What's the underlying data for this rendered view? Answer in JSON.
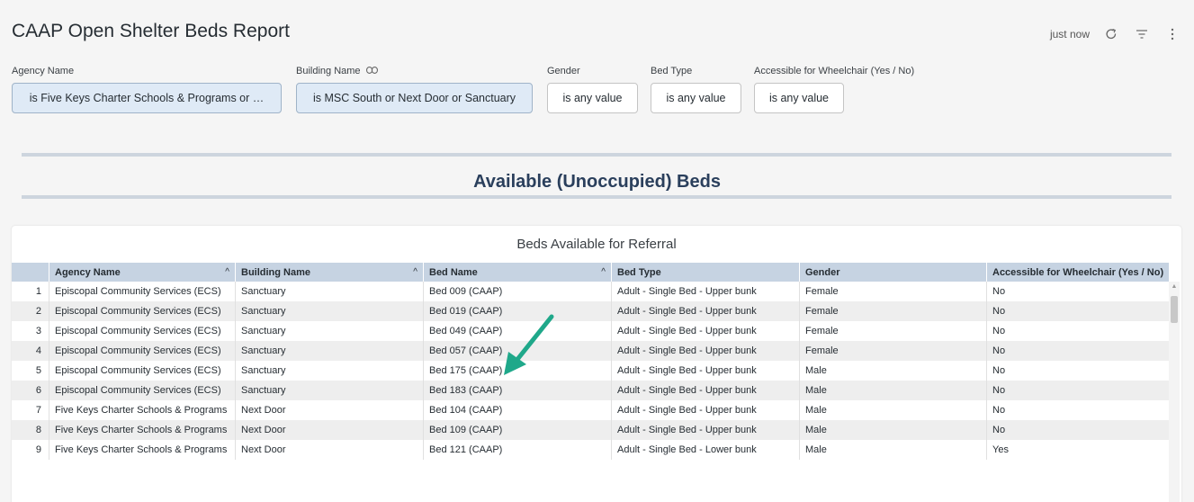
{
  "header": {
    "title": "CAAP Open Shelter Beds Report",
    "refreshed": "just now",
    "icons": [
      "refresh-icon",
      "filter-icon",
      "more-vertical-icon"
    ]
  },
  "filters": [
    {
      "label": "Agency Name",
      "value": "is Five Keys Charter Schools & Programs or …",
      "active": true
    },
    {
      "label": "Building Name",
      "value": "is MSC South or Next Door or Sanctuary",
      "active": true,
      "icon": "link-icon"
    },
    {
      "label": "Gender",
      "value": "is any value",
      "active": false
    },
    {
      "label": "Bed Type",
      "value": "is any value",
      "active": false
    },
    {
      "label": "Accessible for Wheelchair (Yes / No)",
      "value": "is any value",
      "active": false
    }
  ],
  "section": {
    "title": "Available (Unoccupied) Beds"
  },
  "table": {
    "title": "Beds Available for Referral",
    "columns": [
      "",
      "Agency Name",
      "Building Name",
      "Bed Name",
      "Bed Type",
      "Gender",
      "Accessible for Wheelchair (Yes / No)"
    ],
    "rows": [
      [
        "1",
        "Episcopal Community Services (ECS)",
        "Sanctuary",
        "Bed 009 (CAAP)",
        "Adult - Single Bed - Upper bunk",
        "Female",
        "No"
      ],
      [
        "2",
        "Episcopal Community Services (ECS)",
        "Sanctuary",
        "Bed 019 (CAAP)",
        "Adult - Single Bed - Upper bunk",
        "Female",
        "No"
      ],
      [
        "3",
        "Episcopal Community Services (ECS)",
        "Sanctuary",
        "Bed 049 (CAAP)",
        "Adult - Single Bed - Upper bunk",
        "Female",
        "No"
      ],
      [
        "4",
        "Episcopal Community Services (ECS)",
        "Sanctuary",
        "Bed 057 (CAAP)",
        "Adult - Single Bed - Upper bunk",
        "Female",
        "No"
      ],
      [
        "5",
        "Episcopal Community Services (ECS)",
        "Sanctuary",
        "Bed 175 (CAAP)",
        "Adult - Single Bed - Upper bunk",
        "Male",
        "No"
      ],
      [
        "6",
        "Episcopal Community Services (ECS)",
        "Sanctuary",
        "Bed 183 (CAAP)",
        "Adult - Single Bed - Upper bunk",
        "Male",
        "No"
      ],
      [
        "7",
        "Five Keys Charter Schools & Programs",
        "Next Door",
        "Bed 104 (CAAP)",
        "Adult - Single Bed - Upper bunk",
        "Male",
        "No"
      ],
      [
        "8",
        "Five Keys Charter Schools & Programs",
        "Next Door",
        "Bed 109 (CAAP)",
        "Adult - Single Bed - Upper bunk",
        "Male",
        "No"
      ],
      [
        "9",
        "Five Keys Charter Schools & Programs",
        "Next Door",
        "Bed 121 (CAAP)",
        "Adult - Single Bed - Lower bunk",
        "Male",
        "Yes"
      ]
    ]
  },
  "colors": {
    "accent": "#2a3f5c",
    "header_bg": "#c6d3e2",
    "chip_active": "#dfeaf6",
    "annotation_arrow": "#1fa88a"
  }
}
